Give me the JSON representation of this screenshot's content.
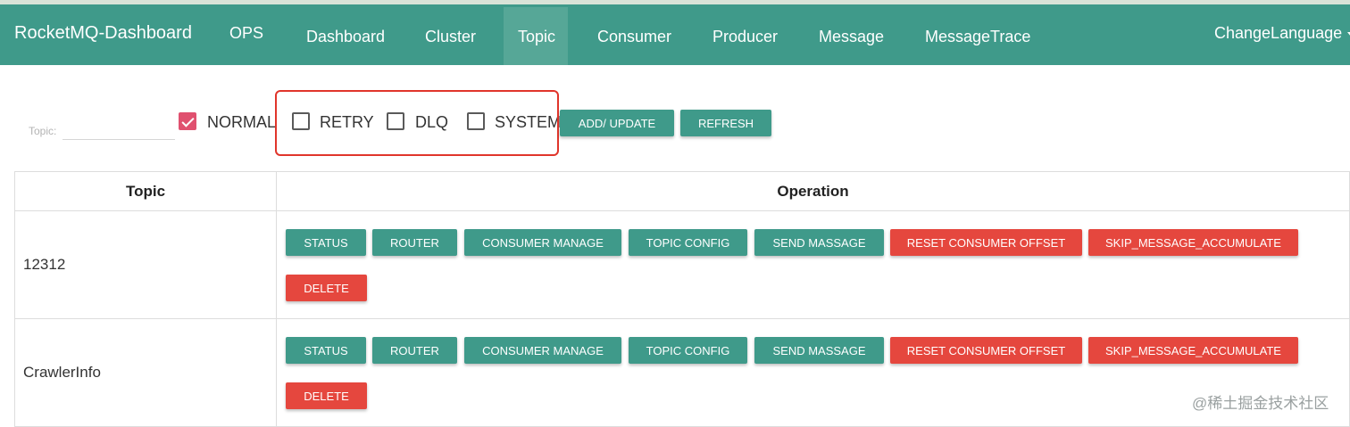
{
  "navbar": {
    "brand": "RocketMQ-Dashboard",
    "items": [
      {
        "label": "OPS"
      },
      {
        "label": "Dashboard"
      },
      {
        "label": "Cluster"
      },
      {
        "label": "Topic"
      },
      {
        "label": "Consumer"
      },
      {
        "label": "Producer"
      },
      {
        "label": "Message"
      },
      {
        "label": "MessageTrace"
      }
    ],
    "active": "Topic",
    "change_language": "ChangeLanguage"
  },
  "filter": {
    "topic_label": "Topic:",
    "topic_value": "",
    "checkboxes": [
      {
        "label": "NORMAL",
        "checked": true
      },
      {
        "label": "RETRY",
        "checked": false
      },
      {
        "label": "DLQ",
        "checked": false
      },
      {
        "label": "SYSTEM",
        "checked": false
      }
    ],
    "add_update_label": "ADD/ UPDATE",
    "refresh_label": "REFRESH"
  },
  "table": {
    "headers": [
      "Topic",
      "Operation"
    ],
    "rows": [
      {
        "topic": "12312"
      },
      {
        "topic": "CrawlerInfo"
      }
    ],
    "row_actions": {
      "status": "STATUS",
      "router": "ROUTER",
      "consumer_manage": "CONSUMER MANAGE",
      "topic_config": "TOPIC CONFIG",
      "send_massage": "SEND MASSAGE",
      "reset_consumer_offset": "RESET CONSUMER OFFSET",
      "skip_message_accumulate": "SKIP_MESSAGE_ACCUMULATE",
      "delete": "DELETE"
    }
  },
  "watermark": "@稀土掘金技术社区",
  "colors": {
    "primary": "#3f9a8a",
    "danger": "#e5473e",
    "checkbox_checked": "#e0506f",
    "highlight_box": "#e0352b"
  }
}
